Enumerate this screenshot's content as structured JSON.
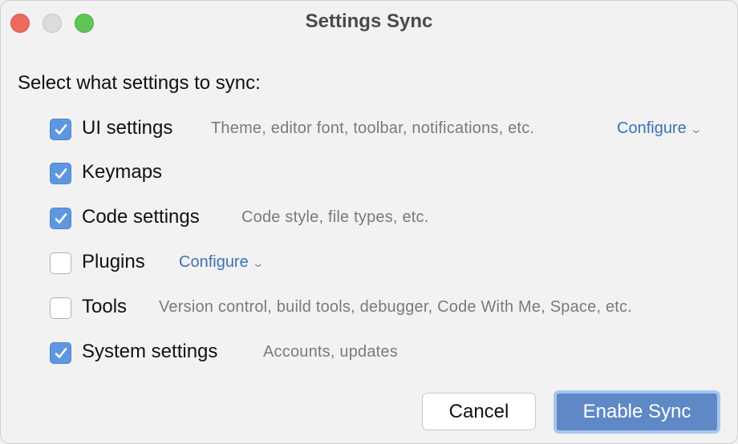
{
  "window": {
    "title": "Settings Sync"
  },
  "prompt": "Select what settings to sync:",
  "items": [
    {
      "label": "UI settings",
      "checked": true,
      "description": "Theme, editor font, toolbar, notifications, etc.",
      "configure": "Configure"
    },
    {
      "label": "Keymaps",
      "checked": true
    },
    {
      "label": "Code settings",
      "checked": true,
      "description": "Code style, file types, etc."
    },
    {
      "label": "Plugins",
      "checked": false,
      "configure": "Configure"
    },
    {
      "label": "Tools",
      "checked": false,
      "description": "Version control, build tools, debugger, Code With Me, Space, etc."
    },
    {
      "label": "System settings",
      "checked": true,
      "description": "Accounts, updates"
    }
  ],
  "buttons": {
    "cancel": "Cancel",
    "enable": "Enable Sync"
  },
  "colors": {
    "accent": "#5e89c6",
    "link": "#3d72b8"
  }
}
